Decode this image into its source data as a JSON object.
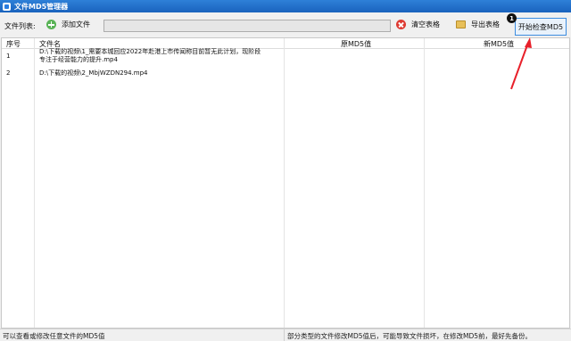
{
  "window": {
    "title": "文件MD5管理器"
  },
  "toolbar": {
    "list_label": "文件列表:",
    "add_file": "添加文件",
    "clear_table": "清空表格",
    "export_table": "导出表格",
    "start_check": "开始检查MD5",
    "badge": "1"
  },
  "table": {
    "headers": [
      "序号",
      "文件名",
      "原MD5值",
      "新MD5值"
    ],
    "rows": [
      {
        "num": "1",
        "filename_line1": "D:\\下载的视频\\1_需要本城回应2022年赴港上市传闻称目前暂无此计划，现阶段",
        "filename_line2": "专注于经营能力的提升.mp4",
        "orig_md5": "",
        "new_md5": ""
      },
      {
        "num": "2",
        "filename_line1": "D:\\下载的视频\\2_MbjWZDN294.mp4",
        "filename_line2": "",
        "orig_md5": "",
        "new_md5": ""
      }
    ]
  },
  "status": {
    "left": "可以查看或修改任意文件的MD5值",
    "right": "部分类型的文件修改MD5值后，可能导致文件损坏，在修改MD5前，最好先备份。"
  },
  "colors": {
    "title_bar": "#1a63bd",
    "annotation": "#e8202a"
  }
}
